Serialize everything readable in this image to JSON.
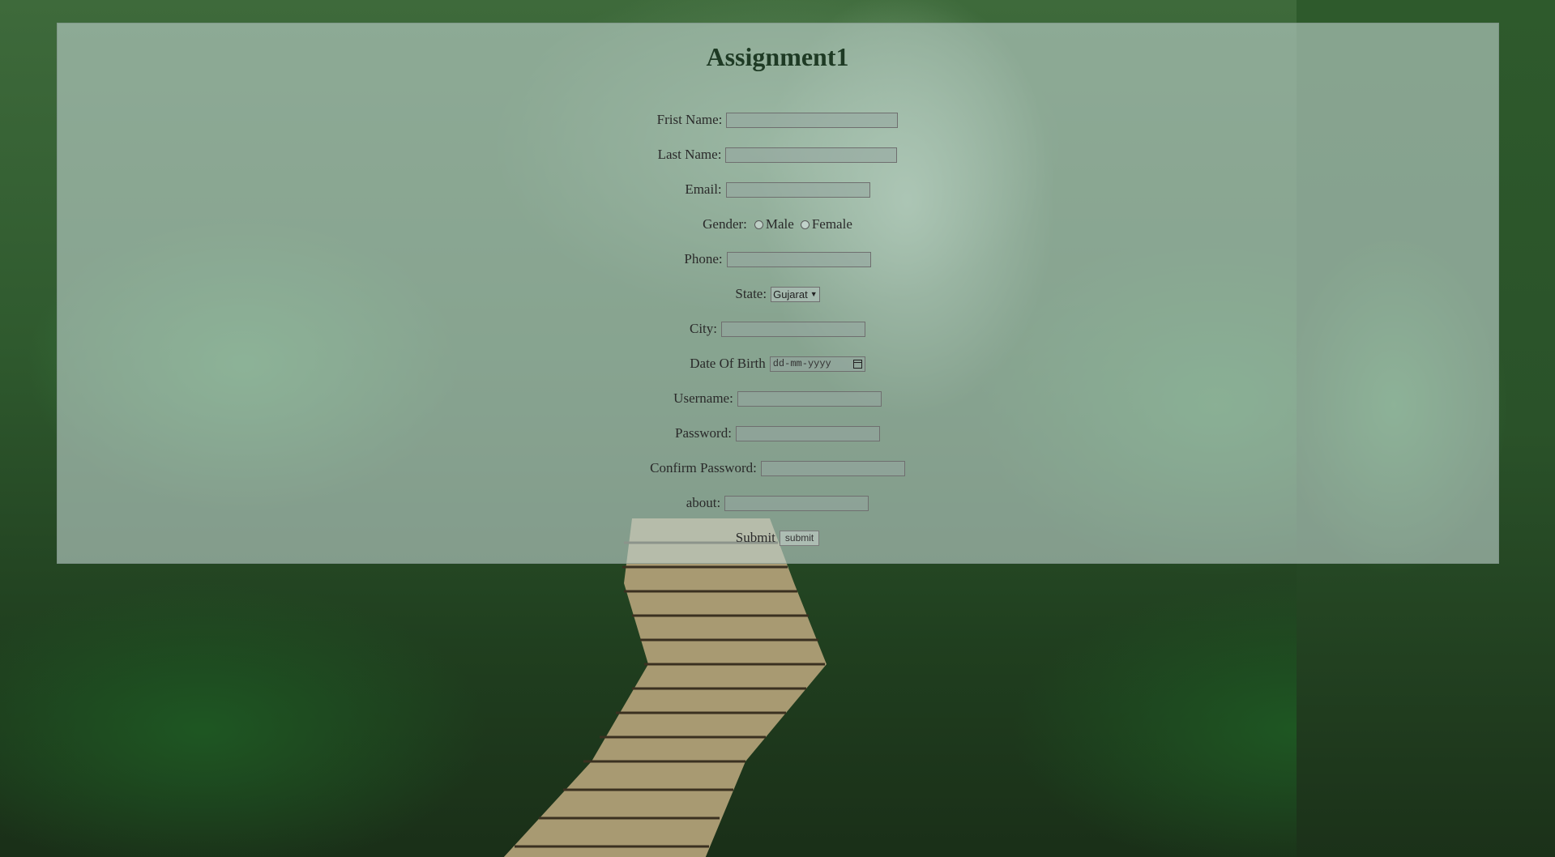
{
  "page": {
    "title": "Assignment1"
  },
  "form": {
    "first_name_label": "Frist Name:",
    "last_name_label": "Last Name:",
    "email_label": "Email:",
    "gender_label": "Gender:",
    "gender_options": [
      "Male",
      "Female"
    ],
    "phone_label": "Phone:",
    "state_label": "State:",
    "state_value": "Gujarat",
    "city_label": "City:",
    "dob_label": "Date Of Birth",
    "dob_placeholder": "dd-mm-yyyy",
    "username_label": "Username:",
    "password_label": "Password:",
    "confirm_password_label": "Confirm Password:",
    "about_label": "about:",
    "submit_label": "Submit",
    "submit_button": "submit"
  },
  "icons": {
    "select_chevron": "chevron-down-icon",
    "date_picker": "calendar-icon"
  },
  "colors": {
    "panel_overlay": "#bed2cd",
    "title_text": "#1e3a24"
  }
}
